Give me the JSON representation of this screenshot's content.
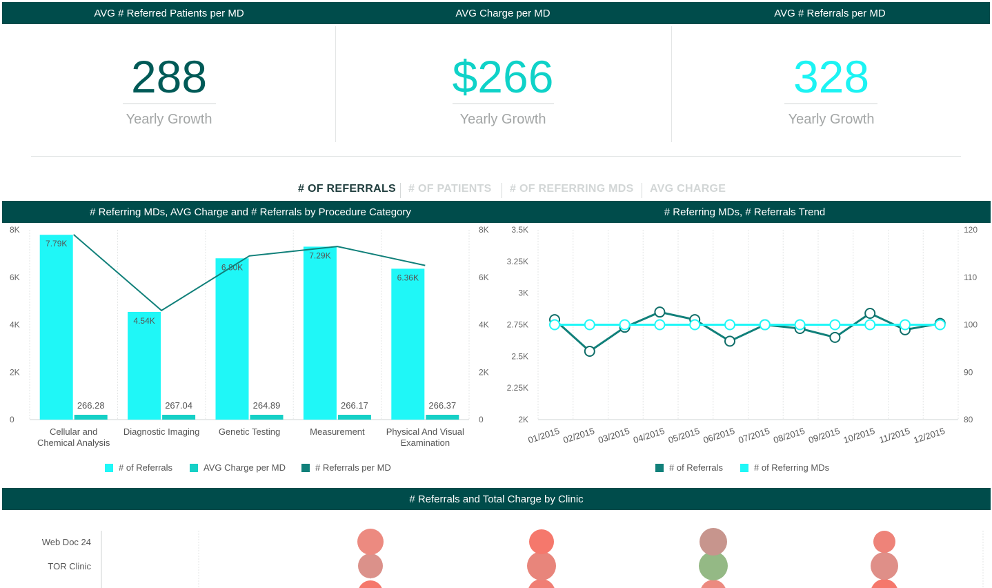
{
  "kpis": [
    {
      "title": "AVG # Referred Patients per MD",
      "value": "288",
      "subtitle": "Yearly Growth",
      "color": "#005a57"
    },
    {
      "title": "AVG Charge per MD",
      "value": "$266",
      "subtitle": "Yearly Growth",
      "color": "#0fd2c8"
    },
    {
      "title": "AVG # Referrals per MD",
      "value": "328",
      "subtitle": "Yearly Growth",
      "color": "#1cf3f3"
    }
  ],
  "tabs": [
    {
      "label": "# OF REFERRALS",
      "active": true
    },
    {
      "label": "# OF PATIENTS",
      "active": false
    },
    {
      "label": "# OF REFERRING MDS",
      "active": false
    },
    {
      "label": "AVG CHARGE",
      "active": false
    }
  ],
  "colors": {
    "header": "#004c4b",
    "cyan": "#1ff7f7",
    "teal": "#15d0c6",
    "dark_teal": "#11807a",
    "tab_active": "#1f3d3d",
    "tab_inactive": "#d2d6d6"
  },
  "chart_data": [
    {
      "title": "# Referring MDs, AVG Charge and # Referrals by Procedure Category",
      "type": "bar",
      "categories": [
        "Cellular and Chemical Analysis",
        "Diagnostic Imaging",
        "Genetic Testing",
        "Measurement",
        "Physical And Visual Examination"
      ],
      "series": [
        {
          "name": "# of Referrals",
          "type": "bar",
          "values": [
            7790,
            4540,
            6800,
            7290,
            6360
          ],
          "labels": [
            "7.79K",
            "4.54K",
            "6.80K",
            "7.29K",
            "6.36K"
          ]
        },
        {
          "name": "AVG Charge per MD",
          "type": "bar",
          "values": [
            266.28,
            267.04,
            264.89,
            266.17,
            266.37
          ],
          "labels": [
            "266.28",
            "267.04",
            "264.89",
            "266.17",
            "266.37"
          ]
        },
        {
          "name": "# Referrals per MD",
          "type": "line",
          "values": [
            7.8,
            4.6,
            6.9,
            7.3,
            6.5
          ]
        }
      ],
      "ylim": [
        0,
        8000
      ],
      "yticks": [
        "0",
        "2K",
        "4K",
        "6K",
        "8K"
      ],
      "y2lim": [
        0,
        8
      ],
      "y2ticks": [
        "0",
        "2K",
        "4K",
        "6K",
        "8K"
      ]
    },
    {
      "title": "# Referring MDs, # Referrals Trend",
      "type": "line",
      "categories": [
        "01/2015",
        "02/2015",
        "03/2015",
        "04/2015",
        "05/2015",
        "06/2015",
        "07/2015",
        "08/2015",
        "09/2015",
        "10/2015",
        "11/2015",
        "12/2015"
      ],
      "series": [
        {
          "name": "# of Referrals",
          "axis": "left",
          "values": [
            2790,
            2540,
            2730,
            2850,
            2790,
            2620,
            2750,
            2720,
            2650,
            2840,
            2710,
            2760
          ]
        },
        {
          "name": "# of Referring MDs",
          "axis": "right",
          "values": [
            100,
            100,
            100,
            100,
            100,
            100,
            100,
            100,
            100,
            100,
            100,
            100
          ]
        }
      ],
      "ylim": [
        2000,
        3500
      ],
      "yticks": [
        "2K",
        "2.25K",
        "2.5K",
        "2.75K",
        "3K",
        "3.25K",
        "3.5K"
      ],
      "y2lim": [
        80,
        120
      ],
      "y2ticks": [
        "80",
        "90",
        "100",
        "110",
        "120"
      ]
    },
    {
      "title": "# Referrals and Total Charge by Clinic",
      "type": "scatter",
      "categories": [
        "Web Doc 24",
        "TOR Clinic"
      ],
      "series": [
        {
          "name": "Web Doc 24",
          "points": [
            {
              "col": 1,
              "color": "#ec8a80",
              "size": 19
            },
            {
              "col": 2,
              "color": "#f5786c",
              "size": 18
            },
            {
              "col": 3,
              "color": "#c7958d",
              "size": 20
            },
            {
              "col": 4,
              "color": "#ee8379",
              "size": 16
            }
          ]
        },
        {
          "name": "TOR Clinic",
          "points": [
            {
              "col": 1,
              "color": "#db918a",
              "size": 18
            },
            {
              "col": 2,
              "color": "#e8857b",
              "size": 21
            },
            {
              "col": 3,
              "color": "#94b985",
              "size": 21
            },
            {
              "col": 4,
              "color": "#df8f88",
              "size": 20
            }
          ]
        }
      ]
    }
  ]
}
